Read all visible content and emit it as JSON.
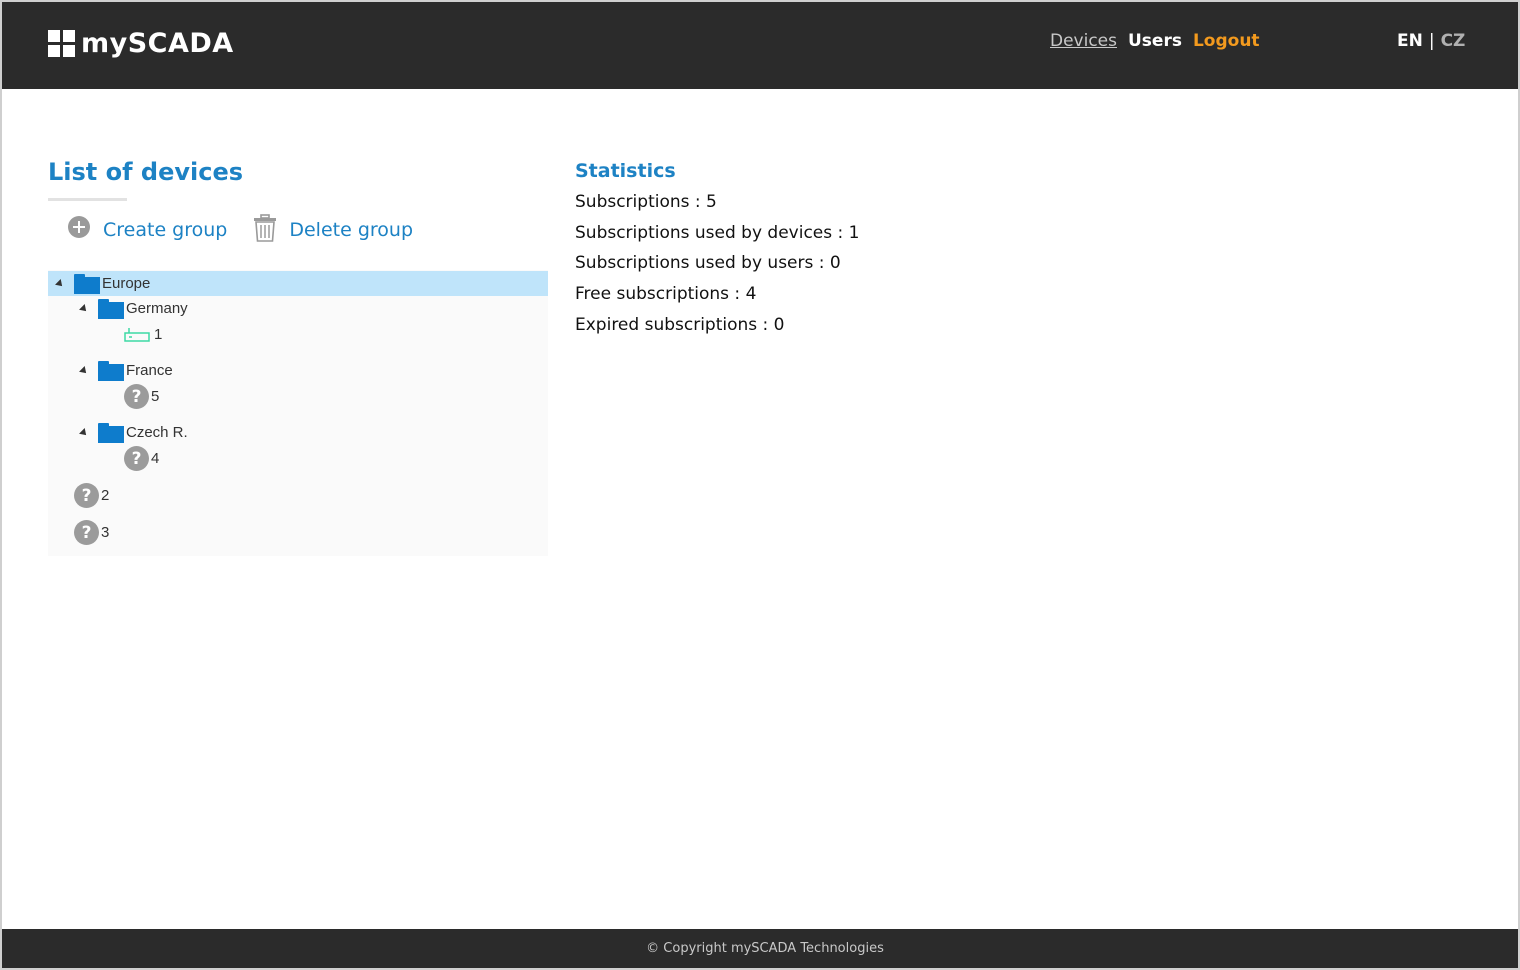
{
  "header": {
    "logo_text": "mySCADA",
    "nav": {
      "devices": "Devices",
      "users": "Users",
      "logout": "Logout"
    },
    "lang": {
      "en": "EN",
      "separator": "|",
      "cz": "CZ"
    },
    "colors": {
      "background": "#2b2b2b",
      "logout": "#f39a1e"
    }
  },
  "main": {
    "title": "List of devices",
    "actions": {
      "create_group": "Create group",
      "delete_group": "Delete group"
    },
    "tree": [
      {
        "label": "Europe",
        "type": "folder",
        "expanded": true,
        "selected": true
      },
      {
        "label": "Germany",
        "type": "folder",
        "expanded": true
      },
      {
        "label": "1",
        "type": "device",
        "status": "online"
      },
      {
        "label": "France",
        "type": "folder",
        "expanded": true
      },
      {
        "label": "5",
        "type": "device",
        "status": "unknown"
      },
      {
        "label": "Czech R.",
        "type": "folder",
        "expanded": true
      },
      {
        "label": "4",
        "type": "device",
        "status": "unknown"
      },
      {
        "label": "2",
        "type": "device",
        "status": "unknown"
      },
      {
        "label": "3",
        "type": "device",
        "status": "unknown"
      }
    ]
  },
  "statistics": {
    "title": "Statistics",
    "items": [
      "Subscriptions : 5",
      "Subscriptions used by devices : 1",
      "Subscriptions used by users : 0",
      "Free subscriptions : 4",
      "Expired subscriptions : 0"
    ],
    "accent_color": "#1d82c4"
  },
  "footer": {
    "text": "© Copyright mySCADA Technologies"
  }
}
